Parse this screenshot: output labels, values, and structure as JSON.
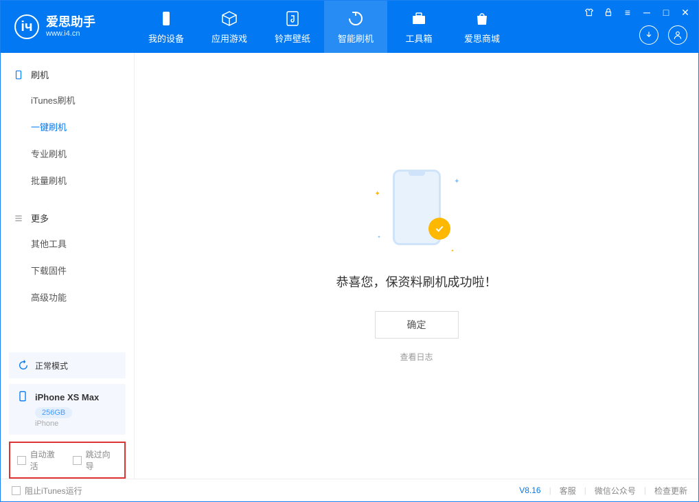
{
  "logo": {
    "title": "爱思助手",
    "sub": "www.i4.cn"
  },
  "nav": {
    "tabs": [
      {
        "label": "我的设备"
      },
      {
        "label": "应用游戏"
      },
      {
        "label": "铃声壁纸"
      },
      {
        "label": "智能刷机"
      },
      {
        "label": "工具箱"
      },
      {
        "label": "爱思商城"
      }
    ]
  },
  "sidebar": {
    "section1": {
      "title": "刷机",
      "items": [
        "iTunes刷机",
        "一键刷机",
        "专业刷机",
        "批量刷机"
      ]
    },
    "section2": {
      "title": "更多",
      "items": [
        "其他工具",
        "下载固件",
        "高级功能"
      ]
    },
    "status": "正常模式",
    "device": {
      "name": "iPhone XS Max",
      "capacity": "256GB",
      "type": "iPhone"
    },
    "checkboxes": {
      "auto_activate": "自动激活",
      "skip_guide": "跳过向导"
    }
  },
  "main": {
    "success": "恭喜您，保资料刷机成功啦！",
    "ok": "确定",
    "log": "查看日志"
  },
  "footer": {
    "block_itunes": "阻止iTunes运行",
    "version": "V8.16",
    "links": [
      "客服",
      "微信公众号",
      "检查更新"
    ]
  }
}
